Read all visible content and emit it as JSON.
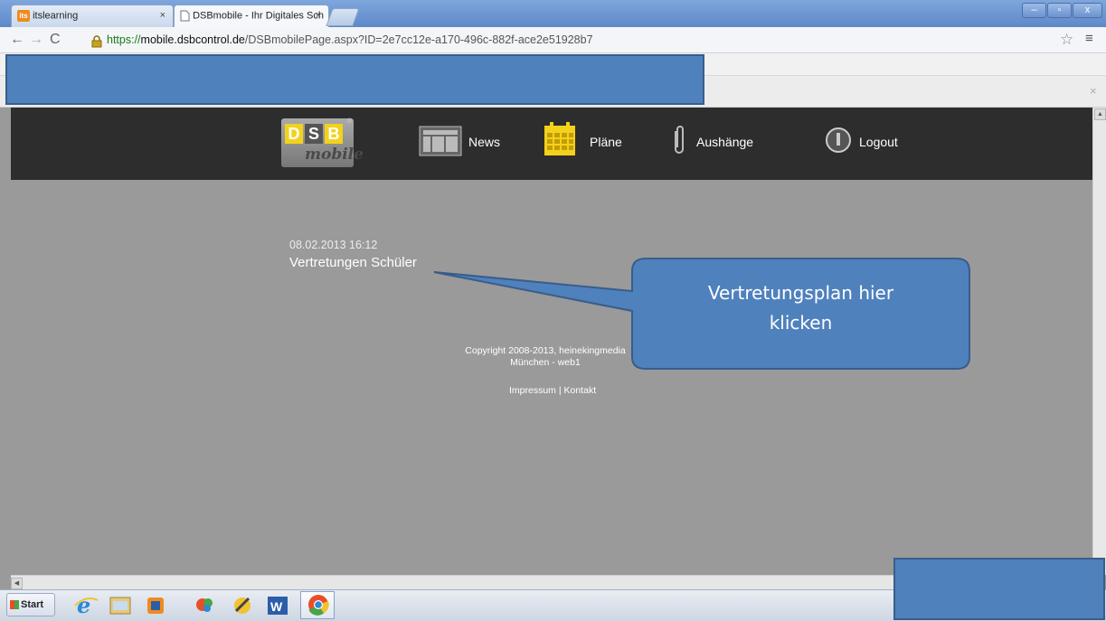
{
  "browser": {
    "tabs": [
      {
        "label": "itslearning",
        "icon": "its-icon",
        "close": "×"
      },
      {
        "label": "DSBmobile - Ihr Digitales Sch",
        "icon": "page-icon",
        "close": "×"
      }
    ],
    "window_buttons": {
      "minimize": "–",
      "maximize": "▫",
      "close": "x"
    },
    "url": {
      "scheme": "https://",
      "host": "mobile.dsbcontrol.de",
      "path": "/DSBmobilePage.aspx?ID=2e7cc12e-a170-496c-882f-ace2e51928b7"
    },
    "icons": [
      "back-icon",
      "forward-icon",
      "reload-icon",
      "lock-icon",
      "star-icon",
      "menu-icon"
    ],
    "infobar_close": "×"
  },
  "dsb": {
    "logo": {
      "letters": [
        "D",
        "S",
        "B"
      ],
      "sub": "mobile",
      "mark": "®"
    },
    "nav": [
      {
        "label": "News",
        "icon": "news-icon"
      },
      {
        "label": "Pläne",
        "icon": "calendar-icon"
      },
      {
        "label": "Aushänge",
        "icon": "paperclip-icon"
      },
      {
        "label": "Logout",
        "icon": "power-icon"
      }
    ],
    "post": {
      "date": "08.02.2013 16:12",
      "title": "Vertretungen Schüler"
    },
    "copyright_line1": "Copyright 2008-2013, heinekingmedia",
    "copyright_line2": "München - web1",
    "footer": {
      "impressum": "Impressum",
      "separator": " | ",
      "kontakt": "Kontakt"
    }
  },
  "callout": {
    "line1": "Vertretungsplan hier",
    "line2": "klicken"
  },
  "taskbar": {
    "start_label": "Start",
    "items": [
      "ie-icon",
      "explorer-icon",
      "media-player-icon",
      "paint-icon",
      "tools-icon",
      "word-icon",
      "chrome-icon"
    ]
  },
  "colors": {
    "header": "#2d2d2d",
    "content": "#9a9a9a",
    "accent_yellow": "#f3d21b",
    "overlay_blue": "#4f81bd"
  }
}
